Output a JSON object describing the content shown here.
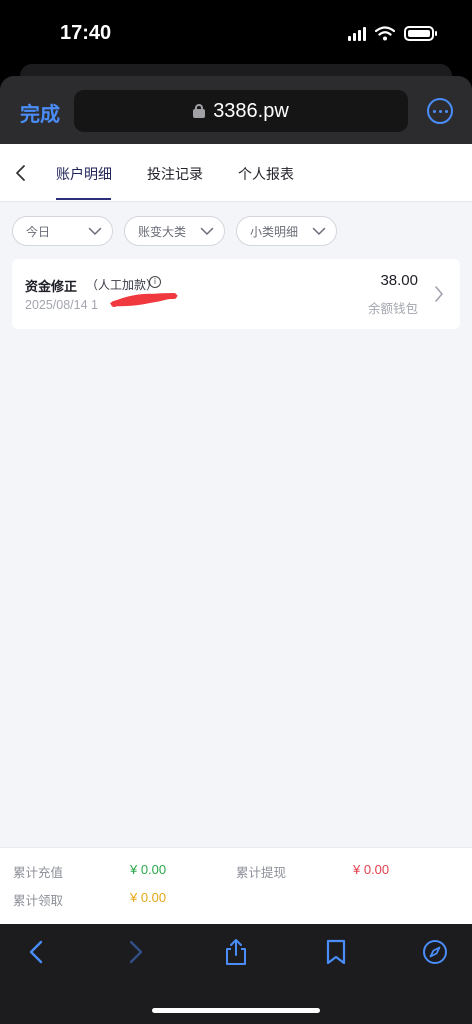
{
  "status_bar": {
    "time": "17:40"
  },
  "browser": {
    "done_label": "完成",
    "url": "3386.pw"
  },
  "tabs": [
    {
      "label": "账户明细",
      "active": true
    },
    {
      "label": "投注记录",
      "active": false
    },
    {
      "label": "个人报表",
      "active": false
    }
  ],
  "filters": [
    {
      "label": "今日"
    },
    {
      "label": "账变大类"
    },
    {
      "label": "小类明细"
    }
  ],
  "record": {
    "title": "资金修正",
    "subtitle": "（人工加款）",
    "time": "2025/08/14 1",
    "amount": "38.00",
    "wallet": "余额钱包"
  },
  "summary": {
    "total_deposit_label": "累计充值",
    "total_deposit_value": "¥ 0.00",
    "total_withdraw_label": "累计提现",
    "total_withdraw_value": "¥ 0.00",
    "total_claim_label": "累计领取",
    "total_claim_value": "¥ 0.00"
  },
  "colors": {
    "accent": "#4a8df8",
    "deposit": "#2aa84a",
    "withdraw": "#e0414f",
    "claim": "#e6a817",
    "tab_indicator": "#2b2f7a"
  }
}
